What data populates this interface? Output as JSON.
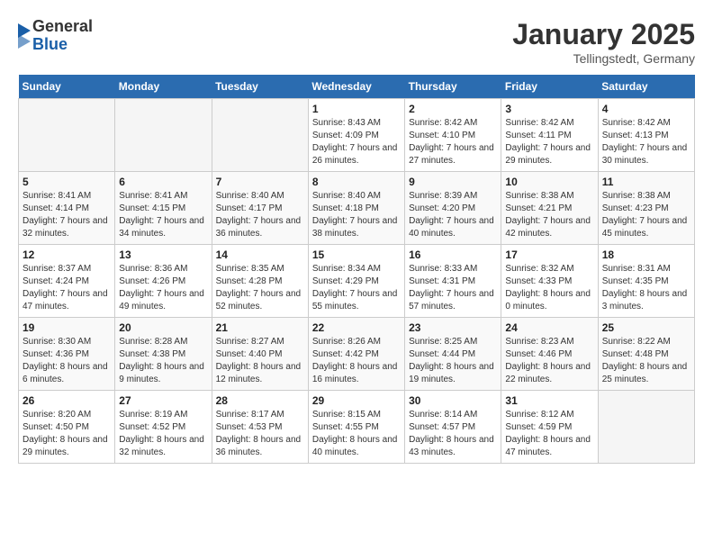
{
  "logo": {
    "general": "General",
    "blue": "Blue"
  },
  "header": {
    "month": "January 2025",
    "location": "Tellingstedt, Germany"
  },
  "weekdays": [
    "Sunday",
    "Monday",
    "Tuesday",
    "Wednesday",
    "Thursday",
    "Friday",
    "Saturday"
  ],
  "weeks": [
    [
      {
        "day": "",
        "sunrise": "",
        "sunset": "",
        "daylight": ""
      },
      {
        "day": "",
        "sunrise": "",
        "sunset": "",
        "daylight": ""
      },
      {
        "day": "",
        "sunrise": "",
        "sunset": "",
        "daylight": ""
      },
      {
        "day": "1",
        "sunrise": "Sunrise: 8:43 AM",
        "sunset": "Sunset: 4:09 PM",
        "daylight": "Daylight: 7 hours and 26 minutes."
      },
      {
        "day": "2",
        "sunrise": "Sunrise: 8:42 AM",
        "sunset": "Sunset: 4:10 PM",
        "daylight": "Daylight: 7 hours and 27 minutes."
      },
      {
        "day": "3",
        "sunrise": "Sunrise: 8:42 AM",
        "sunset": "Sunset: 4:11 PM",
        "daylight": "Daylight: 7 hours and 29 minutes."
      },
      {
        "day": "4",
        "sunrise": "Sunrise: 8:42 AM",
        "sunset": "Sunset: 4:13 PM",
        "daylight": "Daylight: 7 hours and 30 minutes."
      }
    ],
    [
      {
        "day": "5",
        "sunrise": "Sunrise: 8:41 AM",
        "sunset": "Sunset: 4:14 PM",
        "daylight": "Daylight: 7 hours and 32 minutes."
      },
      {
        "day": "6",
        "sunrise": "Sunrise: 8:41 AM",
        "sunset": "Sunset: 4:15 PM",
        "daylight": "Daylight: 7 hours and 34 minutes."
      },
      {
        "day": "7",
        "sunrise": "Sunrise: 8:40 AM",
        "sunset": "Sunset: 4:17 PM",
        "daylight": "Daylight: 7 hours and 36 minutes."
      },
      {
        "day": "8",
        "sunrise": "Sunrise: 8:40 AM",
        "sunset": "Sunset: 4:18 PM",
        "daylight": "Daylight: 7 hours and 38 minutes."
      },
      {
        "day": "9",
        "sunrise": "Sunrise: 8:39 AM",
        "sunset": "Sunset: 4:20 PM",
        "daylight": "Daylight: 7 hours and 40 minutes."
      },
      {
        "day": "10",
        "sunrise": "Sunrise: 8:38 AM",
        "sunset": "Sunset: 4:21 PM",
        "daylight": "Daylight: 7 hours and 42 minutes."
      },
      {
        "day": "11",
        "sunrise": "Sunrise: 8:38 AM",
        "sunset": "Sunset: 4:23 PM",
        "daylight": "Daylight: 7 hours and 45 minutes."
      }
    ],
    [
      {
        "day": "12",
        "sunrise": "Sunrise: 8:37 AM",
        "sunset": "Sunset: 4:24 PM",
        "daylight": "Daylight: 7 hours and 47 minutes."
      },
      {
        "day": "13",
        "sunrise": "Sunrise: 8:36 AM",
        "sunset": "Sunset: 4:26 PM",
        "daylight": "Daylight: 7 hours and 49 minutes."
      },
      {
        "day": "14",
        "sunrise": "Sunrise: 8:35 AM",
        "sunset": "Sunset: 4:28 PM",
        "daylight": "Daylight: 7 hours and 52 minutes."
      },
      {
        "day": "15",
        "sunrise": "Sunrise: 8:34 AM",
        "sunset": "Sunset: 4:29 PM",
        "daylight": "Daylight: 7 hours and 55 minutes."
      },
      {
        "day": "16",
        "sunrise": "Sunrise: 8:33 AM",
        "sunset": "Sunset: 4:31 PM",
        "daylight": "Daylight: 7 hours and 57 minutes."
      },
      {
        "day": "17",
        "sunrise": "Sunrise: 8:32 AM",
        "sunset": "Sunset: 4:33 PM",
        "daylight": "Daylight: 8 hours and 0 minutes."
      },
      {
        "day": "18",
        "sunrise": "Sunrise: 8:31 AM",
        "sunset": "Sunset: 4:35 PM",
        "daylight": "Daylight: 8 hours and 3 minutes."
      }
    ],
    [
      {
        "day": "19",
        "sunrise": "Sunrise: 8:30 AM",
        "sunset": "Sunset: 4:36 PM",
        "daylight": "Daylight: 8 hours and 6 minutes."
      },
      {
        "day": "20",
        "sunrise": "Sunrise: 8:28 AM",
        "sunset": "Sunset: 4:38 PM",
        "daylight": "Daylight: 8 hours and 9 minutes."
      },
      {
        "day": "21",
        "sunrise": "Sunrise: 8:27 AM",
        "sunset": "Sunset: 4:40 PM",
        "daylight": "Daylight: 8 hours and 12 minutes."
      },
      {
        "day": "22",
        "sunrise": "Sunrise: 8:26 AM",
        "sunset": "Sunset: 4:42 PM",
        "daylight": "Daylight: 8 hours and 16 minutes."
      },
      {
        "day": "23",
        "sunrise": "Sunrise: 8:25 AM",
        "sunset": "Sunset: 4:44 PM",
        "daylight": "Daylight: 8 hours and 19 minutes."
      },
      {
        "day": "24",
        "sunrise": "Sunrise: 8:23 AM",
        "sunset": "Sunset: 4:46 PM",
        "daylight": "Daylight: 8 hours and 22 minutes."
      },
      {
        "day": "25",
        "sunrise": "Sunrise: 8:22 AM",
        "sunset": "Sunset: 4:48 PM",
        "daylight": "Daylight: 8 hours and 25 minutes."
      }
    ],
    [
      {
        "day": "26",
        "sunrise": "Sunrise: 8:20 AM",
        "sunset": "Sunset: 4:50 PM",
        "daylight": "Daylight: 8 hours and 29 minutes."
      },
      {
        "day": "27",
        "sunrise": "Sunrise: 8:19 AM",
        "sunset": "Sunset: 4:52 PM",
        "daylight": "Daylight: 8 hours and 32 minutes."
      },
      {
        "day": "28",
        "sunrise": "Sunrise: 8:17 AM",
        "sunset": "Sunset: 4:53 PM",
        "daylight": "Daylight: 8 hours and 36 minutes."
      },
      {
        "day": "29",
        "sunrise": "Sunrise: 8:15 AM",
        "sunset": "Sunset: 4:55 PM",
        "daylight": "Daylight: 8 hours and 40 minutes."
      },
      {
        "day": "30",
        "sunrise": "Sunrise: 8:14 AM",
        "sunset": "Sunset: 4:57 PM",
        "daylight": "Daylight: 8 hours and 43 minutes."
      },
      {
        "day": "31",
        "sunrise": "Sunrise: 8:12 AM",
        "sunset": "Sunset: 4:59 PM",
        "daylight": "Daylight: 8 hours and 47 minutes."
      },
      {
        "day": "",
        "sunrise": "",
        "sunset": "",
        "daylight": ""
      }
    ]
  ]
}
